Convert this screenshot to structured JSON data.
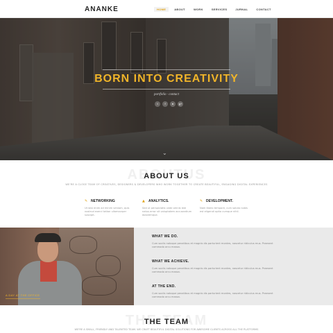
{
  "nav": {
    "logo": "ANANKE",
    "items": [
      {
        "label": "HOME",
        "active": true
      },
      {
        "label": "ABOUT",
        "active": false
      },
      {
        "label": "WORK",
        "active": false
      },
      {
        "label": "SERVICES",
        "active": false
      },
      {
        "label": "JURNAL",
        "active": false
      },
      {
        "label": "CONTACT",
        "active": false
      }
    ]
  },
  "hero": {
    "title": "BORN INTO CREATIVITY",
    "subtitle": "portfolio · contact",
    "socials": [
      {
        "icon": "twitter-icon",
        "glyph": "t"
      },
      {
        "icon": "facebook-icon",
        "glyph": "f"
      },
      {
        "icon": "dribbble-icon",
        "glyph": "●"
      },
      {
        "icon": "google-plus-icon",
        "glyph": "g+"
      }
    ],
    "scroll_glyph": "⌄"
  },
  "about": {
    "bg_word": "ABOUTUS",
    "title": "ABOUT US",
    "lead": "WE'RE A CLOSE TEAM OF CREATIVES, DESIGNERS & DEVELOPERS WHO WORK TOGETHER TO CREATE BEAUTIFUL, ENGAGING DIGITAL EXPERIENCES",
    "services": [
      {
        "icon": "✎",
        "title": "NETWORKING",
        "text": "Ut wisi enim ad minim veniam, quis nostrud exerci tation ullamcorper suscipit."
      },
      {
        "icon": "▲",
        "title": "ANALYTICS.",
        "text": "Sed ut perspiciatis unde omnis iste natus error sit voluptatem accusantium doloremque."
      },
      {
        "icon": "✎",
        "title": "DEVELOPMENT.",
        "text": "Nam libero tempore, cum soluta nobis est eligendi optio cumque nihil."
      }
    ]
  },
  "what": {
    "caption": "A DAY AT THE OFFICE",
    "points": [
      {
        "title": "WHAT WE DO.",
        "text": "Cum sociis natoque penatibus et magnis dis parturient montes, nascetur ridiculus mus. Praesent commodo arcu massa."
      },
      {
        "title": "WHAT WE ACHIEVE.",
        "text": "Cum sociis natoque penatibus et magnis dis parturient montes, nascetur ridiculus mus. Praesent commodo arcu massa."
      },
      {
        "title": "AT THE END.",
        "text": "Cum sociis natoque penatibus et magnis dis parturient montes, nascetur ridiculus mus. Praesent commodo arcu massa."
      }
    ]
  },
  "team": {
    "bg_word": "THE TEAM",
    "title": "THE TEAM",
    "lead": "WE'RE A SMALL, FRIENDLY AND TALENTED TEAM. WE CRAFT BEAUTIFUL DIGITAL SOLUTIONS FOR AWESOME CLIENTS ACROSS ALL THE PLATFORMS"
  }
}
